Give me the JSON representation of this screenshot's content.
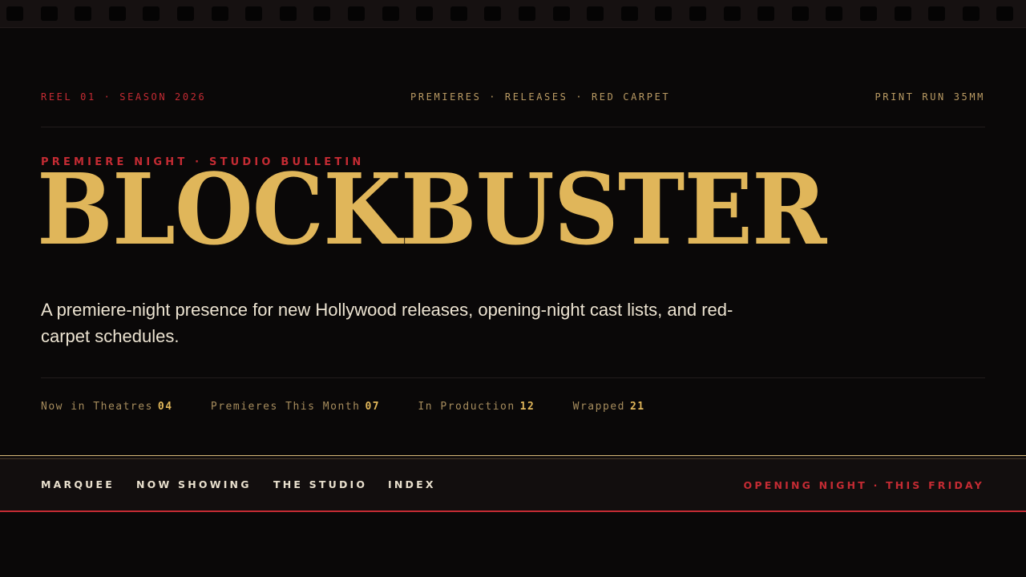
{
  "topbar": {
    "left": "REEL 01 · SEASON 2026",
    "center": "PREMIERES · RELEASES · RED CARPET",
    "right": "PRINT RUN 35MM"
  },
  "hero": {
    "kicker": "PREMIERE NIGHT · STUDIO BULLETIN",
    "title": "BLOCKBUSTER",
    "tagline": "A premiere-night presence for new Hollywood releases, opening-night cast lists, and red-carpet schedules."
  },
  "stats": [
    {
      "label": "Now in Theatres",
      "value": "04"
    },
    {
      "label": "Premieres This Month",
      "value": "07"
    },
    {
      "label": "In Production",
      "value": "12"
    },
    {
      "label": "Wrapped",
      "value": "21"
    }
  ],
  "nav": {
    "items": [
      "MARQUEE",
      "NOW SHOWING",
      "THE STUDIO",
      "INDEX"
    ],
    "cta": "OPENING NIGHT · THIS FRIDAY"
  },
  "colors": {
    "background": "#0a0808",
    "gold": "#e0b65a",
    "red": "#c42b33",
    "muted_gold": "#b99a63",
    "cream": "#ece3d1"
  }
}
